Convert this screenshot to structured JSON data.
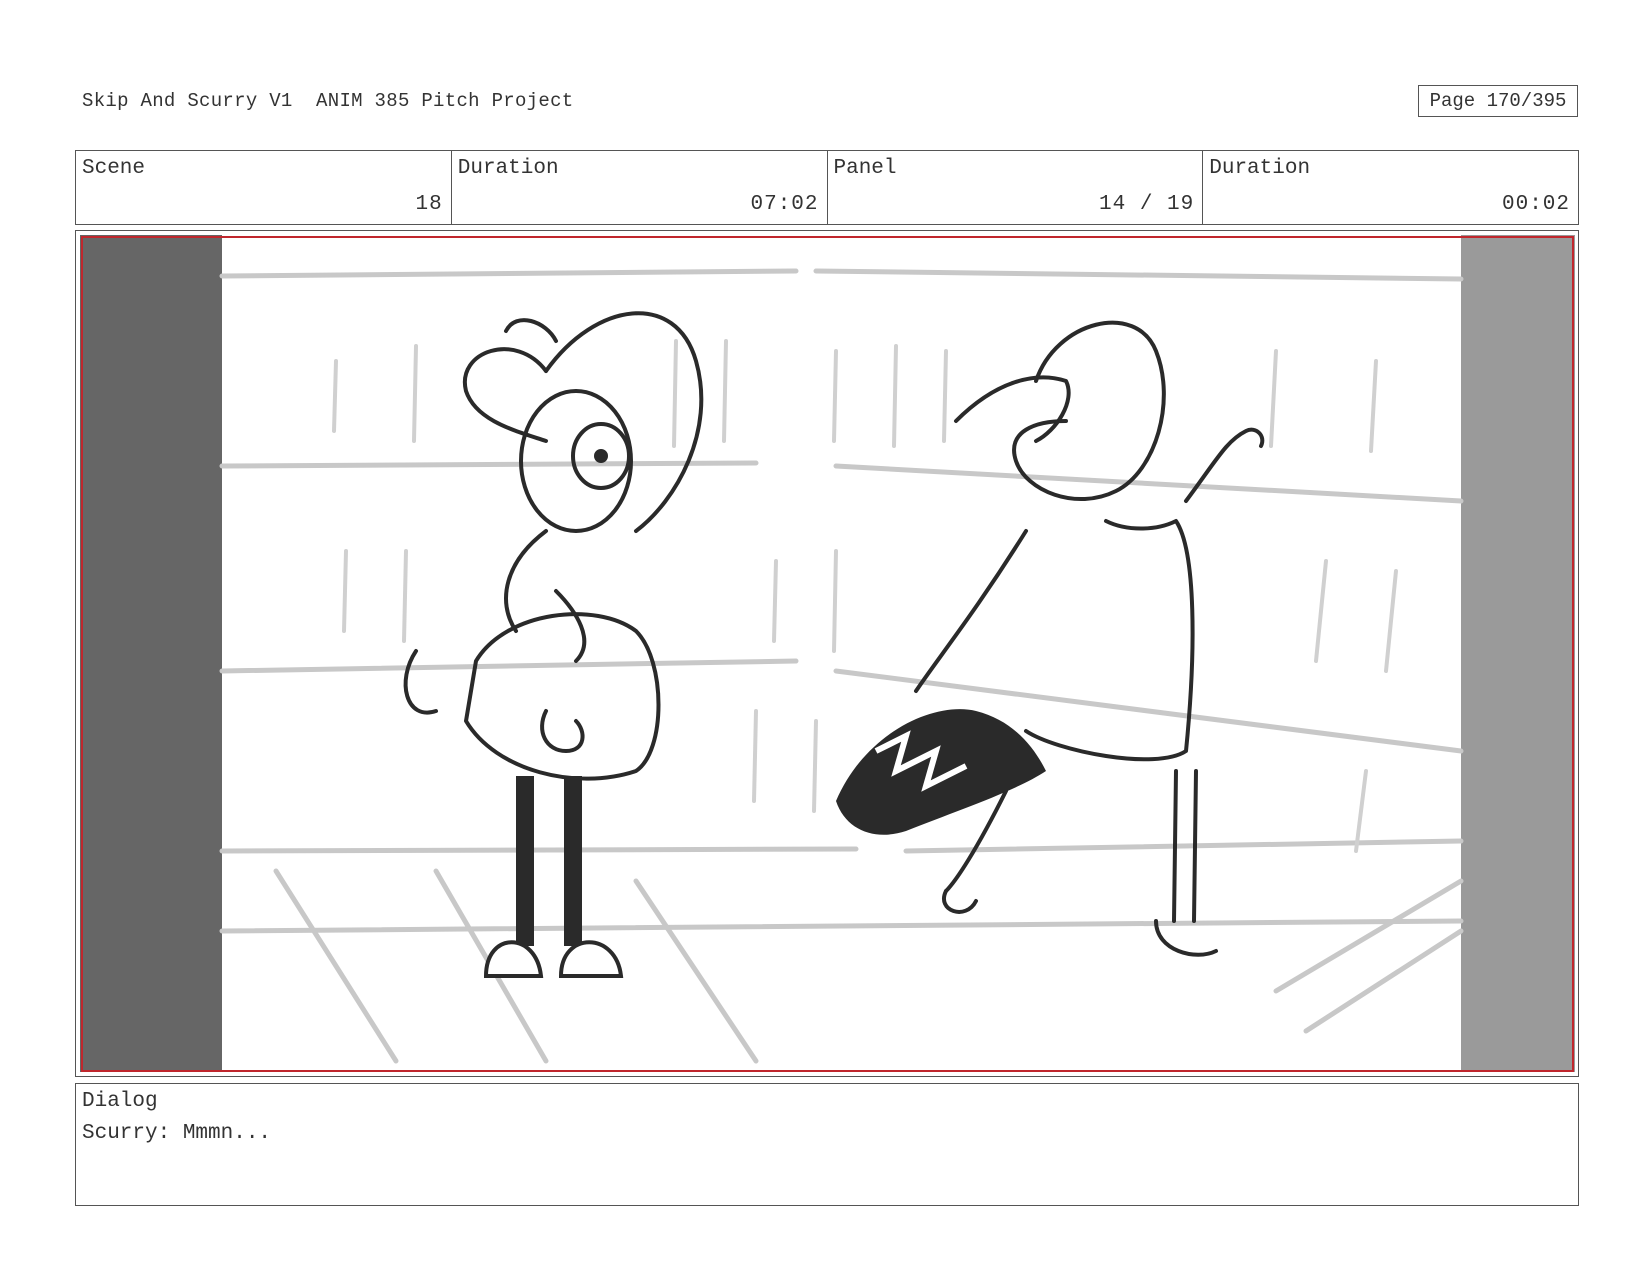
{
  "header": {
    "title": "Skip And Scurry V1  ANIM 385 Pitch Project",
    "page": "Page 170/395"
  },
  "info": {
    "scene_label": "Scene",
    "scene_value": "18",
    "duration_label": "Duration",
    "duration_value": "07:02",
    "panel_label": "Panel",
    "panel_value": "14 / 19",
    "panel_duration_label": "Duration",
    "panel_duration_value": "00:02"
  },
  "dialog": {
    "label": "Dialog",
    "text": "Scurry: Mmmn..."
  },
  "colors": {
    "safe_frame": "#c0272d",
    "left_bar": "#666666",
    "right_bar": "#9a9a9a",
    "sketch_line": "#2a2a2a",
    "background_sketch": "#c8c8c8"
  }
}
